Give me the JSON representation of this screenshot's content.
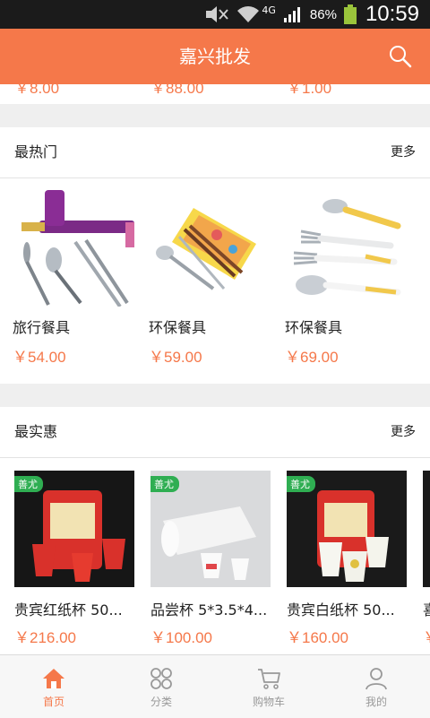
{
  "status_bar": {
    "network": "4G",
    "battery_percent": "86%",
    "time": "10:59"
  },
  "header": {
    "title": "嘉兴批发",
    "search_icon": "search-icon"
  },
  "colors": {
    "accent": "#f5784a",
    "status_bar": "#1b1b1b",
    "background": "#efefef"
  },
  "previous_row_prices": [
    "￥8.00",
    "￥88.00",
    "￥1.00"
  ],
  "hottest": {
    "title": "最热门",
    "more": "更多",
    "items": [
      {
        "name": "旅行餐具",
        "price": "￥54.00"
      },
      {
        "name": "环保餐具",
        "price": "￥59.00"
      },
      {
        "name": "环保餐具",
        "price": "￥69.00"
      }
    ]
  },
  "best_value": {
    "title": "最实惠",
    "more": "更多",
    "badge": "善尤",
    "items": [
      {
        "name": "贵宾红纸杯 50...",
        "price": "￥216.00"
      },
      {
        "name": "品尝杯 5*3.5*4...",
        "price": "￥100.00"
      },
      {
        "name": "贵宾白纸杯 50...",
        "price": "￥160.00"
      },
      {
        "name": "喜",
        "price": "￥"
      }
    ]
  },
  "bottom_nav": [
    {
      "label": "首页",
      "icon": "home-icon",
      "active": true
    },
    {
      "label": "分类",
      "icon": "category-icon",
      "active": false
    },
    {
      "label": "购物车",
      "icon": "cart-icon",
      "active": false
    },
    {
      "label": "我的",
      "icon": "user-icon",
      "active": false
    }
  ]
}
